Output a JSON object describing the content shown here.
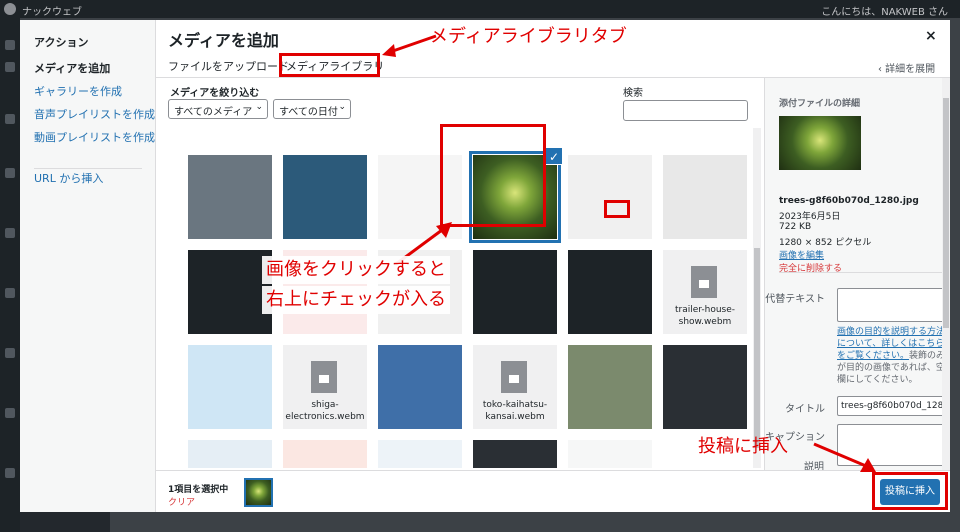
{
  "adminbar": {
    "site": "ナックウェブ",
    "greeting": "こんにちは、NAKWEB さん"
  },
  "modal": {
    "title": "メディアを追加",
    "close": "×",
    "tabs": [
      {
        "label": "ファイルをアップロード"
      },
      {
        "label": "メディアライブラリ",
        "active": true
      }
    ],
    "details_toggle": "‹ 詳細を展開"
  },
  "menu": {
    "header": "アクション",
    "items": [
      {
        "label": "メディアを追加",
        "active": true
      },
      {
        "label": "ギャラリーを作成"
      },
      {
        "label": "音声プレイリストを作成"
      },
      {
        "label": "動画プレイリストを作成"
      }
    ],
    "url_insert": "URL から挿入"
  },
  "filters": {
    "label": "メディアを絞り込む",
    "type_select": "すべてのメディア",
    "date_select": "すべての日付",
    "search_label": "検索",
    "search_value": ""
  },
  "grid": {
    "items": [
      {
        "kind": "image",
        "color": "#6a7680"
      },
      {
        "kind": "image",
        "color": "#2c5a7a"
      },
      {
        "kind": "image",
        "color": "#f5f5f5"
      },
      {
        "kind": "image",
        "color": "#3f6b2c",
        "selected": true
      },
      {
        "kind": "image",
        "color": "#f0f0f0"
      },
      {
        "kind": "image",
        "color": "#e8e8e8"
      },
      {
        "kind": "image",
        "color": "#1d2327"
      },
      {
        "kind": "image",
        "color": "#fbeaea"
      },
      {
        "kind": "image",
        "color": "#f0f0f0"
      },
      {
        "kind": "image",
        "color": "#1d2327"
      },
      {
        "kind": "image",
        "color": "#1d2327"
      },
      {
        "kind": "video",
        "name": "trailer-house-show.webm"
      },
      {
        "kind": "image",
        "color": "#cfe6f5"
      },
      {
        "kind": "video",
        "name": "shiga-electronics.webm"
      },
      {
        "kind": "image",
        "color": "#3f6fa8"
      },
      {
        "kind": "video",
        "name": "toko-kaihatsu-kansai.webm"
      },
      {
        "kind": "image",
        "color": "#7b8a6d"
      },
      {
        "kind": "image",
        "color": "#2a2f34"
      },
      {
        "kind": "image",
        "color": "#e5eef5"
      },
      {
        "kind": "image",
        "color": "#fbe7e2"
      },
      {
        "kind": "image",
        "color": "#edf3f8"
      },
      {
        "kind": "image",
        "color": "#2a2f34"
      },
      {
        "kind": "image",
        "color": "#f6f7f7"
      },
      {
        "kind": "image",
        "color": "#ffffff"
      }
    ]
  },
  "details": {
    "heading": "添付ファイルの詳細",
    "filename": "trees-g8f60b070d_1280.jpg",
    "date": "2023年6月5日",
    "size": "722 KB",
    "dimensions": "1280 × 852 ピクセル",
    "edit_link": "画像を編集",
    "delete_link": "完全に削除する",
    "alt_label": "代替テキスト",
    "alt_help_link": "画像の目的を説明する方法について、詳しくはこちらをご覧ください。",
    "alt_help_text": "装飾のみが目的の画像であれば、空欄にしてください。",
    "title_label": "タイトル",
    "title_value": "trees-g8f60b070d_1280",
    "caption_label": "キャプション",
    "desc_label": "説明"
  },
  "footer": {
    "selected_count": "1項目を選択中",
    "clear": "クリア",
    "insert_button": "投稿に挿入"
  },
  "annotations": {
    "library_tab": "メディアライブラリタブ",
    "click_line1": "画像をクリックすると",
    "click_line2": "右上にチェックが入る",
    "insert": "投稿に挿入",
    "color": "#e00000"
  }
}
